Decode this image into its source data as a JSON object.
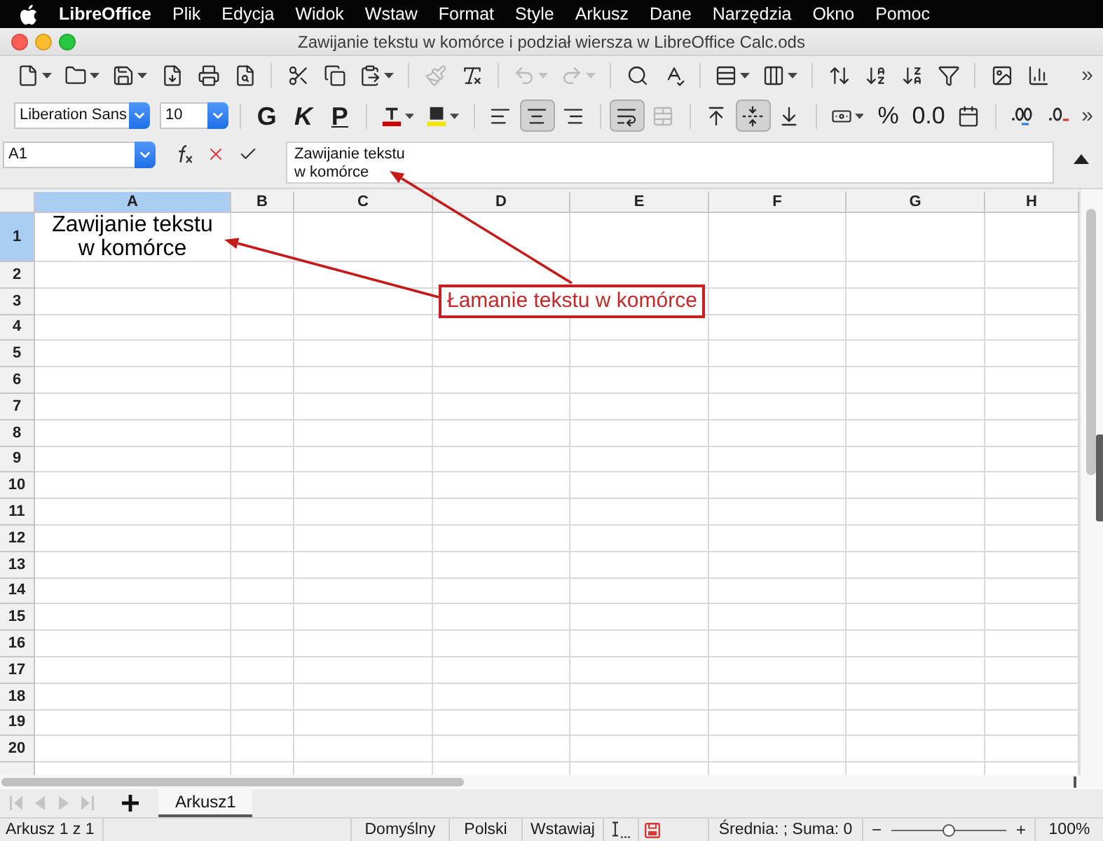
{
  "menu_bar": {
    "app_name": "LibreOffice",
    "items": [
      "Plik",
      "Edycja",
      "Widok",
      "Wstaw",
      "Format",
      "Style",
      "Arkusz",
      "Dane",
      "Narzędzia",
      "Okno",
      "Pomoc"
    ]
  },
  "window": {
    "title": "Zawijanie tekstu w komórce i podział wiersza w LibreOffice Calc.ods"
  },
  "standard_toolbar": {
    "groups": [
      [
        {
          "kind": "icon",
          "menu": true,
          "disabled": false
        },
        {
          "kind": "icon",
          "menu": true,
          "disabled": false
        },
        {
          "kind": "icon",
          "menu": true,
          "disabled": false
        },
        {
          "kind": "icon",
          "menu": false,
          "disabled": false
        },
        {
          "kind": "icon",
          "menu": false,
          "disabled": false
        },
        {
          "kind": "icon",
          "menu": false,
          "disabled": false
        }
      ],
      [
        {
          "kind": "icon",
          "menu": false,
          "disabled": false
        },
        {
          "kind": "icon",
          "menu": false,
          "disabled": false
        },
        {
          "kind": "icon",
          "menu": true,
          "disabled": false
        }
      ],
      [
        {
          "kind": "icon",
          "menu": false,
          "disabled": true
        },
        {
          "kind": "icon",
          "menu": false,
          "disabled": false
        }
      ],
      [
        {
          "kind": "icon",
          "menu": true,
          "disabled": true
        },
        {
          "kind": "icon",
          "menu": true,
          "disabled": true
        }
      ],
      [
        {
          "kind": "icon",
          "menu": false,
          "disabled": false
        },
        {
          "kind": "icon",
          "menu": false,
          "disabled": false
        }
      ],
      [
        {
          "kind": "icon",
          "menu": true,
          "disabled": false
        },
        {
          "kind": "icon",
          "menu": true,
          "disabled": false
        }
      ],
      [
        {
          "kind": "icon",
          "menu": false,
          "disabled": false
        },
        {
          "kind": "icon",
          "menu": false,
          "disabled": false
        },
        {
          "kind": "icon",
          "menu": false,
          "disabled": false
        },
        {
          "kind": "icon",
          "menu": false,
          "disabled": false
        }
      ],
      [
        {
          "kind": "icon",
          "menu": false,
          "disabled": false
        },
        {
          "kind": "icon",
          "menu": false,
          "disabled": false
        }
      ]
    ],
    "overflow": "»"
  },
  "formatting_toolbar": {
    "font_name": "Liberation Sans",
    "font_size": "10",
    "groups": [
      [
        {
          "kind": "bold",
          "label": "G",
          "menu": false,
          "pressed": false,
          "disabled": false
        },
        {
          "kind": "italic",
          "label": "K",
          "menu": false,
          "pressed": false,
          "disabled": false
        },
        {
          "kind": "underline",
          "label": "P",
          "menu": false,
          "pressed": false,
          "disabled": false
        }
      ],
      [
        {
          "kind": "icon",
          "menu": true,
          "pressed": false,
          "disabled": false
        },
        {
          "kind": "icon",
          "menu": true,
          "pressed": false,
          "disabled": false
        }
      ],
      [
        {
          "kind": "icon",
          "menu": false,
          "pressed": false,
          "disabled": false
        },
        {
          "kind": "icon",
          "menu": false,
          "pressed": true,
          "disabled": false
        },
        {
          "kind": "icon",
          "menu": false,
          "pressed": false,
          "disabled": false
        }
      ],
      [
        {
          "kind": "icon",
          "menu": false,
          "pressed": true,
          "disabled": false
        },
        {
          "kind": "icon",
          "menu": false,
          "pressed": false,
          "disabled": true
        }
      ],
      [
        {
          "kind": "icon",
          "menu": false,
          "pressed": false,
          "disabled": false
        },
        {
          "kind": "icon",
          "menu": false,
          "pressed": true,
          "disabled": false
        },
        {
          "kind": "icon",
          "menu": false,
          "pressed": false,
          "disabled": false
        }
      ],
      [
        {
          "kind": "icon",
          "menu": true,
          "pressed": false,
          "disabled": false
        },
        {
          "kind": "text",
          "label": "%",
          "menu": false,
          "pressed": false,
          "disabled": false
        },
        {
          "kind": "text",
          "label": "0.0",
          "menu": false,
          "pressed": false,
          "disabled": false
        },
        {
          "kind": "icon",
          "menu": false,
          "pressed": false,
          "disabled": false
        }
      ],
      [
        {
          "kind": "icon",
          "menu": false,
          "pressed": false,
          "disabled": false
        },
        {
          "kind": "icon",
          "menu": false,
          "pressed": false,
          "disabled": false
        }
      ]
    ],
    "overflow": "»"
  },
  "formula_bar": {
    "name_box": "A1",
    "content": "Zawijanie tekstu\nw komórce"
  },
  "sheet": {
    "columns": [
      {
        "label": "A",
        "selected": true
      },
      {
        "label": "B",
        "selected": false
      },
      {
        "label": "C",
        "selected": false
      },
      {
        "label": "D",
        "selected": false
      },
      {
        "label": "E",
        "selected": false
      },
      {
        "label": "F",
        "selected": false
      },
      {
        "label": "G",
        "selected": false
      },
      {
        "label": "H",
        "selected": false
      }
    ],
    "rows": [
      {
        "label": "1",
        "selected": true,
        "cells": [
          "Zawijanie tekstu\nw komórce"
        ]
      },
      {
        "label": "2",
        "selected": false
      },
      {
        "label": "3",
        "selected": false
      },
      {
        "label": "4",
        "selected": false
      },
      {
        "label": "5",
        "selected": false
      },
      {
        "label": "6",
        "selected": false
      },
      {
        "label": "7",
        "selected": false
      },
      {
        "label": "8",
        "selected": false
      },
      {
        "label": "9",
        "selected": false
      },
      {
        "label": "10",
        "selected": false
      },
      {
        "label": "11",
        "selected": false
      },
      {
        "label": "12",
        "selected": false
      },
      {
        "label": "13",
        "selected": false
      },
      {
        "label": "14",
        "selected": false
      },
      {
        "label": "15",
        "selected": false
      },
      {
        "label": "16",
        "selected": false
      },
      {
        "label": "17",
        "selected": false
      },
      {
        "label": "18",
        "selected": false
      },
      {
        "label": "19",
        "selected": false
      },
      {
        "label": "20",
        "selected": false
      }
    ]
  },
  "sheet_tabs": {
    "navigation_disabled": true,
    "tabs": [
      {
        "label": "Arkusz1",
        "selected": true
      }
    ]
  },
  "status_bar": {
    "sheet_position": "Arkusz 1 z 1",
    "page_style": "Domyślny",
    "language": "Polski",
    "input_mode": "Wstawiaj",
    "modified": true,
    "summary": "Średnia: ; Suma: 0",
    "zoom": {
      "minus": "−",
      "plus": "+",
      "level": 0.5,
      "reading": "100%"
    }
  },
  "callout": {
    "text": "Łamanie tekstu w komórce"
  }
}
